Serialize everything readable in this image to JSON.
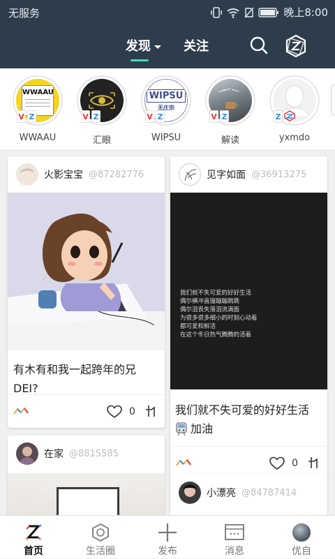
{
  "status_bar": {
    "carrier": "无服务",
    "time": "晚上8:00"
  },
  "top_nav": {
    "tabs": [
      {
        "label": "发现",
        "active": true
      },
      {
        "label": "关注",
        "active": false
      }
    ],
    "icons": [
      "search-icon",
      "app-logo-icon"
    ]
  },
  "stories": [
    {
      "label": "WWAAU",
      "badge": [
        "V",
        "Z"
      ]
    },
    {
      "label": "汇眼",
      "badge": [
        "V",
        "Z"
      ]
    },
    {
      "label": "WIPSU",
      "badge": [
        "V",
        "Z"
      ]
    },
    {
      "label": "解读",
      "badge": [
        "V",
        "Z"
      ]
    },
    {
      "label": "yxmdo",
      "badge": [
        "Z"
      ]
    }
  ],
  "story_art": {
    "wwaau_text": "WWAAU",
    "wipsu_text": "WIPSU",
    "wipsu_sub": "无庄宗"
  },
  "posts": [
    {
      "username": "火影宝宝",
      "user_id": "@87282776",
      "caption": "有木有和我一起跨年的兄DEI?",
      "likes": "0"
    },
    {
      "username": "见字如面",
      "user_id": "@36913275",
      "image_text": [
        "我们就不失可爱的好好生活",
        "偶尔横冲直撞蹦蹦跳跳",
        "偶尔沮丧失落泪流满面",
        "为很多很多细小的时刻心动着",
        "都可爱和鲜活",
        "在这个冬日热气腾腾的活着"
      ],
      "caption_line1": "我们就不失可爱的好好生活",
      "caption_line2": "加油",
      "likes": "0"
    },
    {
      "username": "在家",
      "user_id": "@8815585"
    },
    {
      "username": "小漂亮",
      "user_id": "@84787414"
    }
  ],
  "tab_bar": [
    {
      "label": "首页",
      "icon": "home-logo-icon",
      "active": true
    },
    {
      "label": "生活圈",
      "icon": "lifecircle-icon",
      "active": false
    },
    {
      "label": "发布",
      "icon": "plus-icon",
      "active": false
    },
    {
      "label": "消息",
      "icon": "message-icon",
      "active": false
    },
    {
      "label": "优自",
      "icon": "avatar-icon",
      "active": false
    }
  ],
  "colors": {
    "header_bg": "#2d3d4c",
    "accent": "#3ee0b1"
  }
}
